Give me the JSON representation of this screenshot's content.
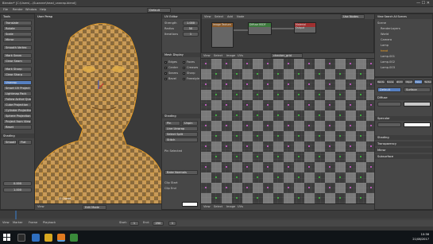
{
  "window": {
    "title": "Blender* [C:\\Users\\...\\Suzanne\\head_unwrap.blend]"
  },
  "topbar": {
    "menus": [
      "File",
      "Render",
      "Window",
      "Help"
    ],
    "layout": "Default"
  },
  "tools": {
    "section_header": "Tools",
    "buttons": [
      "Translate",
      "Rotate",
      "Scale",
      "Mirror",
      "Smooth Vertex",
      "Mark Seam",
      "Clear Seam",
      "Mark Sharp",
      "Clear Sharp",
      "Unwrap",
      "Smart UV Project",
      "Lightmap Pack",
      "Follow Active Quads",
      "Cube Projection",
      "Cylinder Projection",
      "Sphere Projection",
      "Project from View",
      "Reset"
    ],
    "shading_header": "Shading",
    "shading_buttons": [
      "Smooth",
      "Flat"
    ],
    "field_values": [
      "0.000",
      "1.000"
    ]
  },
  "viewport": {
    "header": "User Persp",
    "footer_object": "(1) head",
    "menu": "View",
    "mode": "Edit Mode"
  },
  "uv_props": {
    "section_header": "UV Editor",
    "fields": [
      {
        "label": "Strength",
        "value": "1.000"
      },
      {
        "label": "Radius",
        "value": "50"
      },
      {
        "label": "Iterations",
        "value": "1"
      }
    ],
    "section2": "Mesh Display",
    "checks": [
      "Edges",
      "Faces",
      "Center",
      "Creases",
      "Seams",
      "Sharp",
      "Bevel",
      "Freestyle"
    ],
    "section3": "Shading",
    "buttons": [
      "Pin",
      "Unpin",
      "Live Unwrap",
      "Select Split",
      "Stitch"
    ],
    "pin_label": "Pin Selected",
    "render_btn": "Bake Normals",
    "clip_labels": [
      "Clip Start",
      "Clip End"
    ]
  },
  "node_editor": {
    "menus": [
      "View",
      "Select",
      "Add",
      "Node"
    ],
    "material": "Material",
    "image_label": "Image",
    "node_labels": [
      "Image Texture",
      "Diffuse BSDF",
      "Material Output"
    ],
    "use_nodes": "Use Nodes"
  },
  "uv_editor": {
    "menus": [
      "View",
      "Select",
      "Image",
      "UVs"
    ],
    "image_name": "checker_grid",
    "footer_menus": [
      "View",
      "Select",
      "Image",
      "UVs"
    ]
  },
  "outliner": {
    "header": "View Search All Scenes",
    "items": [
      "Scene",
      "RenderLayers",
      "World",
      "Camera",
      "Lamp",
      "head",
      "Lamp.001",
      "Lamp.002",
      "Lamp.003"
    ]
  },
  "properties": {
    "tabs": [
      "Render",
      "Scene",
      "World",
      "Object",
      "Material",
      "Texture"
    ],
    "rows": [
      "Default",
      "Surface",
      "Diffuse",
      "Specular",
      "Shading",
      "Transparency",
      "Mirror",
      "Subsurface"
    ]
  },
  "timeline": {
    "menus": [
      "View",
      "Marker",
      "Frame",
      "Playback"
    ],
    "start_label": "Start:",
    "start": "1",
    "end_label": "End:",
    "end": "250",
    "frame": "1"
  },
  "taskbar": {
    "time": "10:36",
    "date": "21/08/2017"
  }
}
